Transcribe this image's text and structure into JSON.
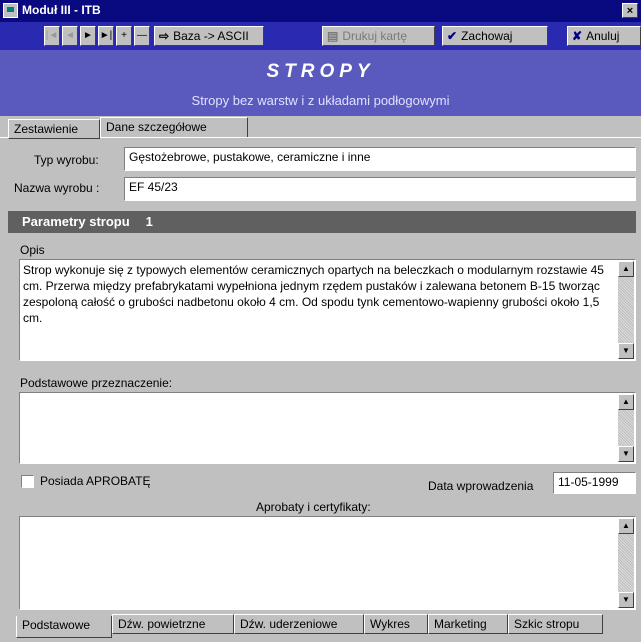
{
  "window": {
    "title": "Moduł III - ITB",
    "close_glyph": "×"
  },
  "toolbar": {
    "nav": [
      "|◄",
      "◄",
      "►",
      "►|",
      "+",
      "—"
    ],
    "baza_label": "Baza -> ASCII",
    "drukuj_label": "Drukuj kartę",
    "zachowaj_label": "Zachowaj",
    "anuluj_label": "Anuluj"
  },
  "header": {
    "title": "STROPY",
    "subtitle": "Stropy bez warstw i z układami podłogowymi"
  },
  "tabs": [
    "Zestawienie",
    "Dane szczegółowe"
  ],
  "form": {
    "typ_label": "Typ wyrobu:",
    "typ_value": "Gęstożebrowe, pustakowe, ceramiczne i inne",
    "nazwa_label": "Nazwa wyrobu :",
    "nazwa_value": "EF 45/23"
  },
  "params": {
    "label": "Parametry stropu",
    "number": "1"
  },
  "opis": {
    "label": "Opis",
    "text": "Strop wykonuje się z typowych elementów ceramicznych opartych na beleczkach o modularnym rozstawie 45 cm. Przerwa między prefabrykatami wypełniona jednym rzędem pustaków i zalewana betonem B-15 tworząc zespoloną całość o grubości nadbetonu około 4 cm. Od spodu tynk cementowo-wapienny grubości około 1,5 cm."
  },
  "przeznaczenie": {
    "label": "Podstawowe przeznaczenie:",
    "value": ""
  },
  "aprobata": {
    "label": "Posiada APROBATĘ",
    "checked": false
  },
  "data_wprowadzenia": {
    "label": "Data wprowadzenia",
    "value": "11-05-1999"
  },
  "aprobaty": {
    "label": "Aprobaty i certyfikaty:",
    "value": ""
  },
  "bottom_tabs": [
    "Podstawowe",
    "Dźw. powietrzne",
    "Dźw. uderzeniowe",
    "Wykres",
    "Marketing",
    "Szkic stropu"
  ],
  "colors": {
    "titlebar": "#0a0a80",
    "toolbar": "#2a2ab0",
    "header": "#5a5abe",
    "params_bar": "#606060"
  }
}
